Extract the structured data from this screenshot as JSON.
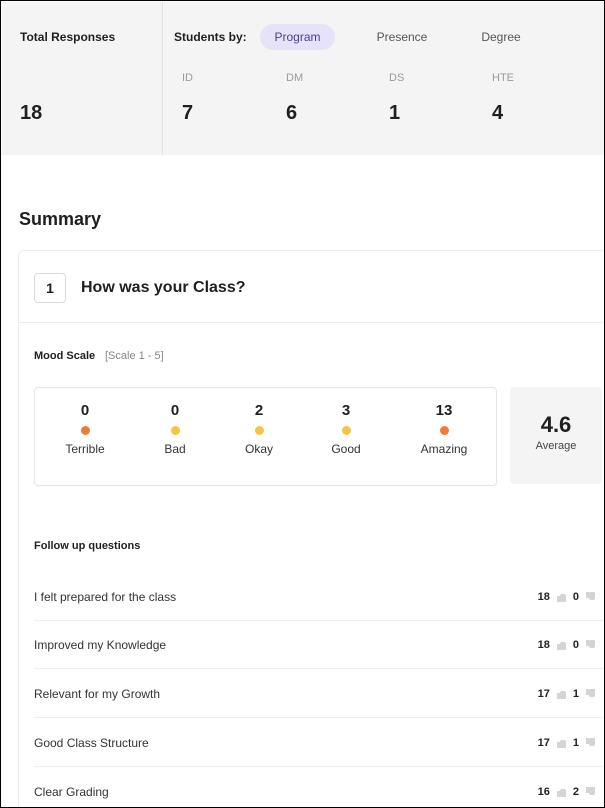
{
  "stats": {
    "total_label": "Total Responses",
    "total_value": "18",
    "students_by_label": "Students by:",
    "tabs": [
      "Program",
      "Presence",
      "Degree"
    ],
    "active_tab": "Program",
    "columns": [
      {
        "label": "ID",
        "value": "7"
      },
      {
        "label": "DM",
        "value": "6"
      },
      {
        "label": "DS",
        "value": "1"
      },
      {
        "label": "HTE",
        "value": "4"
      }
    ]
  },
  "summary_title": "Summary",
  "question": {
    "number": "1",
    "title": "How was your Class?",
    "mood_label": "Mood Scale",
    "mood_scale": "[Scale 1 - 5]",
    "moods": [
      {
        "count": "0",
        "name": "Terrible",
        "icon": "angry-face-icon"
      },
      {
        "count": "0",
        "name": "Bad",
        "icon": "sad-face-icon"
      },
      {
        "count": "2",
        "name": "Okay",
        "icon": "neutral-face-icon"
      },
      {
        "count": "3",
        "name": "Good",
        "icon": "smile-face-icon"
      },
      {
        "count": "13",
        "name": "Amazing",
        "icon": "heart-eyes-face-icon"
      }
    ],
    "average_value": "4.6",
    "average_label": "Average",
    "followup_title": "Follow up questions",
    "followups": [
      {
        "text": "I felt prepared for the class",
        "up": "18",
        "down": "0"
      },
      {
        "text": "Improved my Knowledge",
        "up": "18",
        "down": "0"
      },
      {
        "text": "Relevant for my Growth",
        "up": "17",
        "down": "1"
      },
      {
        "text": "Good Class Structure",
        "up": "17",
        "down": "1"
      },
      {
        "text": "Clear Grading",
        "up": "16",
        "down": "2"
      }
    ]
  },
  "colors": {
    "accent_pill_bg": "#e6e2f7",
    "accent_pill_text": "#4a3f8f",
    "panel_bg": "#f4f4f4"
  }
}
